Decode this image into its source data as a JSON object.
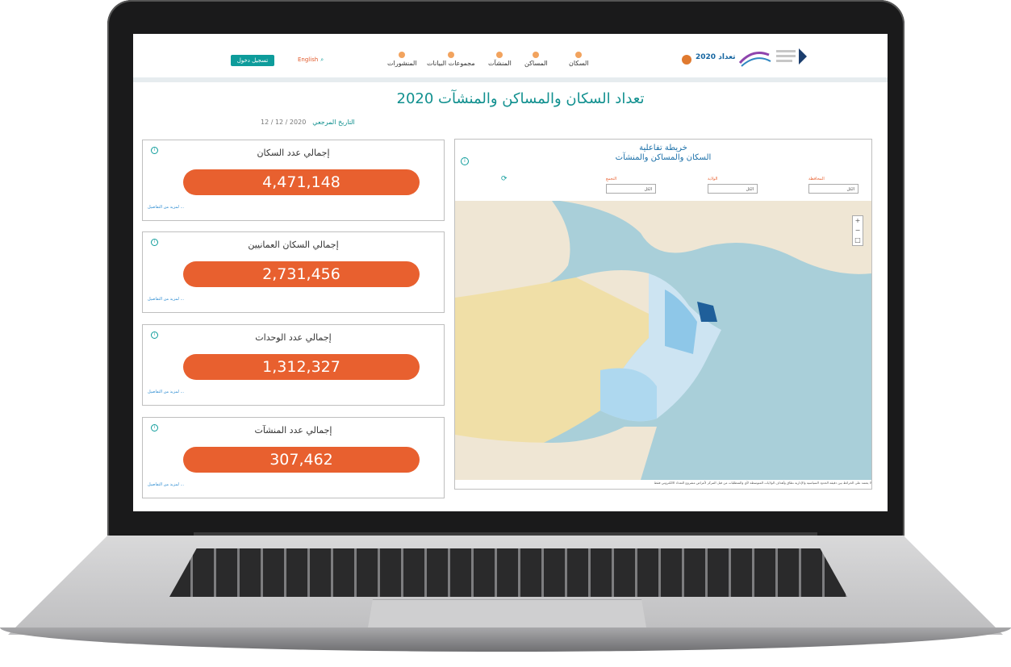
{
  "header": {
    "nav": [
      {
        "label": "السكان"
      },
      {
        "label": "المساكن"
      },
      {
        "label": "المنشآت"
      },
      {
        "label": "مجموعات البيانات"
      },
      {
        "label": "المنشورات"
      }
    ],
    "login_label": "تسجيل دخول",
    "language_label": "English",
    "brand_label": "تعداد 2020"
  },
  "page": {
    "title": "تعداد السكان والمساكن والمنشآت 2020",
    "reference_label": "التاريخ المرجعي",
    "reference_date": "12 / 12 / 2020"
  },
  "cards": [
    {
      "title": "إجمالي عدد السكان",
      "value": "4,471,148",
      "more": "لمزيد من التفاصيل ..."
    },
    {
      "title": "إجمالي السكان العمانيين",
      "value": "2,731,456",
      "more": "لمزيد من التفاصيل ..."
    },
    {
      "title": "إجمالي عدد الوحدات",
      "value": "1,312,327",
      "more": "لمزيد من التفاصيل ..."
    },
    {
      "title": "إجمالي عدد المنشآت",
      "value": "307,462",
      "more": "لمزيد من التفاصيل ..."
    }
  ],
  "map": {
    "title_line1": "خريطة تفاعلية",
    "title_line2": "السكان والمساكن والمنشآت",
    "filters": [
      {
        "label": "المحافظة",
        "value": "الكل"
      },
      {
        "label": "الولاية",
        "value": "الكل"
      },
      {
        "label": "التجمع",
        "value": "الكل"
      }
    ],
    "disclaimer": "لا يعتمد على الخرائط بين دقيقة الحدود السياسية والإدارية نطاق وأهداف الولايات المتوسطة لأي والمتطلبات من قبل المركز لأغراض مشروع التعداد الالكتروني فقط"
  },
  "colors": {
    "teal": "#0e9c9b",
    "orange": "#e8602f",
    "sea": "#a9cfd9",
    "land": "#efe6d4",
    "desert": "#f0dfa7"
  }
}
